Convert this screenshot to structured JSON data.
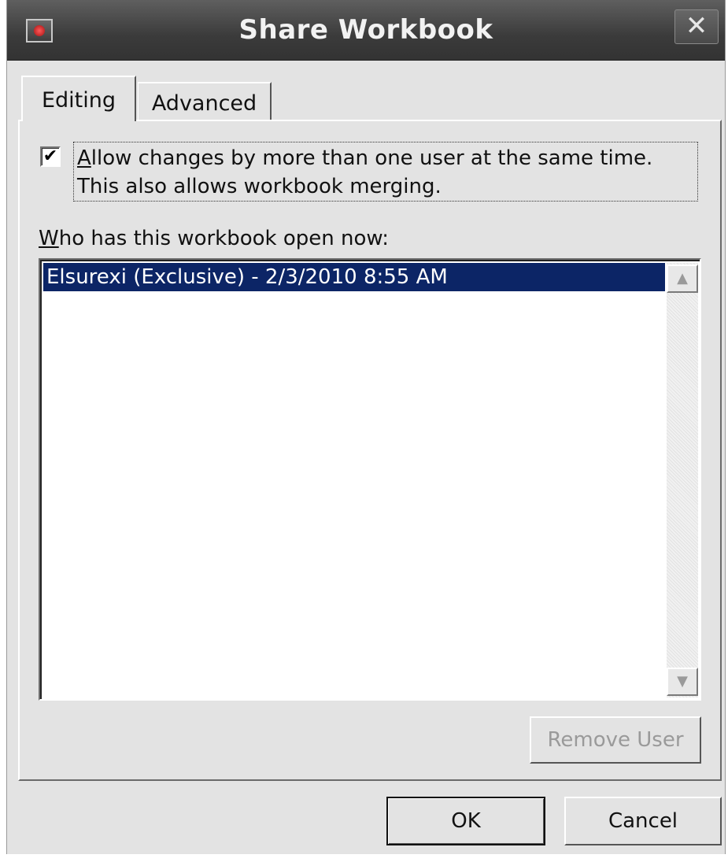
{
  "window": {
    "title": "Share Workbook",
    "close_glyph": "✕",
    "icon": "excel-app-icon"
  },
  "tabs": [
    {
      "label": "Editing",
      "selected": true
    },
    {
      "label": "Advanced",
      "selected": false
    }
  ],
  "editing": {
    "allow_changes": {
      "checked": true,
      "check_glyph": "✔",
      "label_accel": "A",
      "label_rest": "llow changes by more than one user at the same time.  This also allows workbook merging."
    },
    "who_label_accel": "W",
    "who_label_rest": "ho has this workbook open now:",
    "users": [
      {
        "text": "Elsurexi (Exclusive) - 2/3/2010 8:55 AM",
        "selected": true
      }
    ],
    "scroll_up_glyph": "▲",
    "scroll_down_glyph": "▼",
    "remove_user_label": "Remove User",
    "remove_user_enabled": false
  },
  "footer": {
    "ok_label": "OK",
    "cancel_label": "Cancel"
  },
  "colors": {
    "selection": "#0c2566",
    "dialog_bg": "#e3e3e3",
    "titlebar": "#3b3b3b"
  }
}
